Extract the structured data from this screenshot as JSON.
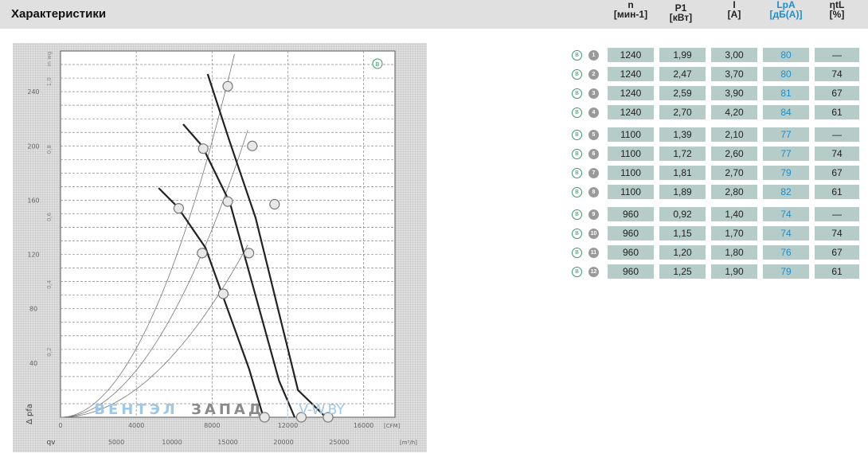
{
  "header": {
    "title": "Характеристики",
    "columns": [
      {
        "symbol": "n",
        "unit": "[мин-1]"
      },
      {
        "symbol": "P1",
        "unit": "[кВт]"
      },
      {
        "symbol": "I",
        "unit": "[A]"
      },
      {
        "symbol": "LpA",
        "unit": "[дБ(A)]"
      },
      {
        "symbol": "ηtL",
        "unit": "[%]"
      }
    ]
  },
  "rows": [
    {
      "num": "1",
      "n": "1240",
      "p1": "1,99",
      "i": "3,00",
      "lpa": "80",
      "eta": "—"
    },
    {
      "num": "2",
      "n": "1240",
      "p1": "2,47",
      "i": "3,70",
      "lpa": "80",
      "eta": "74"
    },
    {
      "num": "3",
      "n": "1240",
      "p1": "2,59",
      "i": "3,90",
      "lpa": "81",
      "eta": "67"
    },
    {
      "num": "4",
      "n": "1240",
      "p1": "2,70",
      "i": "4,20",
      "lpa": "84",
      "eta": "61"
    },
    {
      "num": "5",
      "n": "1100",
      "p1": "1,39",
      "i": "2,10",
      "lpa": "77",
      "eta": "—"
    },
    {
      "num": "6",
      "n": "1100",
      "p1": "1,72",
      "i": "2,60",
      "lpa": "77",
      "eta": "74"
    },
    {
      "num": "7",
      "n": "1100",
      "p1": "1,81",
      "i": "2,70",
      "lpa": "79",
      "eta": "67"
    },
    {
      "num": "8",
      "n": "1100",
      "p1": "1,89",
      "i": "2,80",
      "lpa": "82",
      "eta": "61"
    },
    {
      "num": "9",
      "n": "960",
      "p1": "0,92",
      "i": "1,40",
      "lpa": "74",
      "eta": "—"
    },
    {
      "num": "10",
      "n": "960",
      "p1": "1,15",
      "i": "1,70",
      "lpa": "74",
      "eta": "74"
    },
    {
      "num": "11",
      "n": "960",
      "p1": "1,20",
      "i": "1,80",
      "lpa": "76",
      "eta": "67"
    },
    {
      "num": "12",
      "n": "960",
      "p1": "1,25",
      "i": "1,90",
      "lpa": "79",
      "eta": "61"
    }
  ],
  "badge_letter": "B",
  "chart_data": {
    "type": "line",
    "y_ticks": [
      "40",
      "80",
      "120",
      "160",
      "200",
      "240"
    ],
    "y_ticks_left": [
      "in wg"
    ],
    "y_ticks_inner": [
      "0,2",
      "0,4",
      "0,6",
      "0,8",
      "1,0"
    ],
    "x_ticks_cfm": [
      "0",
      "4000",
      "8000",
      "12000",
      "16000"
    ],
    "x_unit_cfm": "[CFM]",
    "x_ticks_m3h": [
      "5000",
      "10000",
      "15000",
      "20000",
      "25000"
    ],
    "x_unit_m3h": "[m³/h]",
    "y_axis_label": "Δ pfa",
    "x_axis_label": "qv",
    "curve_badge": "B",
    "series": [
      {
        "speed": "1240",
        "x": [
          13200,
          15100,
          17500,
          21300,
          23800
        ],
        "y": [
          253,
          205,
          147,
          20,
          0
        ]
      },
      {
        "speed": "1100",
        "x": [
          11000,
          12700,
          15200,
          19600,
          21000
        ],
        "y": [
          216,
          200,
          158,
          27,
          0
        ]
      },
      {
        "speed": "960",
        "x": [
          8800,
          10500,
          13000,
          16900,
          18200
        ],
        "y": [
          169,
          155,
          125,
          36,
          0
        ]
      }
    ],
    "points": [
      {
        "x": 15000,
        "y": 244
      },
      {
        "x": 17200,
        "y": 200
      },
      {
        "x": 19200,
        "y": 157
      },
      {
        "x": 12800,
        "y": 198
      },
      {
        "x": 15000,
        "y": 159
      },
      {
        "x": 16900,
        "y": 121
      },
      {
        "x": 10600,
        "y": 154
      },
      {
        "x": 12700,
        "y": 121
      },
      {
        "x": 14600,
        "y": 91
      },
      {
        "x": 18300,
        "y": 0
      },
      {
        "x": 21600,
        "y": 0
      },
      {
        "x": 24000,
        "y": 0
      }
    ],
    "xlim": [
      0,
      30000
    ],
    "ylim": [
      0,
      270
    ]
  },
  "watermark": {
    "part1": "ВЕНТЭЛ",
    "part2": "ЗАПАД",
    "part3": "V-W.BY"
  }
}
